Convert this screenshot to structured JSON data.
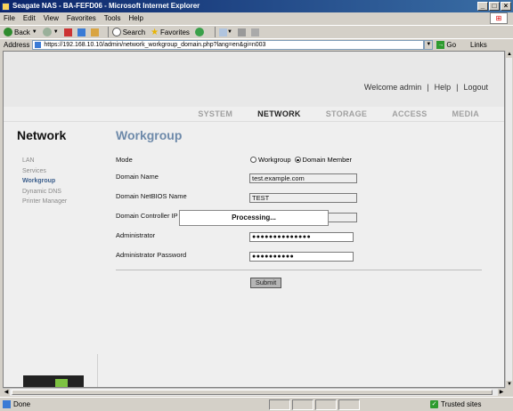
{
  "window": {
    "title": "Seagate NAS - BA-FEFD06 - Microsoft Internet Explorer"
  },
  "menubar": [
    {
      "label": "File"
    },
    {
      "label": "Edit"
    },
    {
      "label": "View"
    },
    {
      "label": "Favorites"
    },
    {
      "label": "Tools"
    },
    {
      "label": "Help"
    }
  ],
  "toolbar": {
    "back_label": "Back",
    "search_label": "Search",
    "favorites_label": "Favorites"
  },
  "address": {
    "label": "Address",
    "url": "https://192.168.10.10/admin/network_workgroup_domain.php?lang=en&gi=n003",
    "go_label": "Go",
    "links_label": "Links"
  },
  "header": {
    "welcome": "Welcome admin",
    "sep": "|",
    "help": "Help",
    "logout": "Logout"
  },
  "navtabs": [
    {
      "label": "SYSTEM",
      "active": false
    },
    {
      "label": "NETWORK",
      "active": true
    },
    {
      "label": "STORAGE",
      "active": false
    },
    {
      "label": "ACCESS",
      "active": false
    },
    {
      "label": "MEDIA",
      "active": false
    }
  ],
  "sidebar": {
    "title": "Network",
    "items": [
      {
        "label": "LAN",
        "active": false
      },
      {
        "label": "Services",
        "active": false
      },
      {
        "label": "Workgroup",
        "active": true
      },
      {
        "label": "Dynamic DNS",
        "active": false
      },
      {
        "label": "Printer Manager",
        "active": false
      }
    ]
  },
  "main": {
    "title": "Workgroup",
    "mode_label": "Mode",
    "mode_options": [
      {
        "label": "Workgroup",
        "checked": false
      },
      {
        "label": "Domain Member",
        "checked": true
      }
    ],
    "domain_name_label": "Domain Name",
    "domain_name_value": "test.example.com",
    "netbios_label": "Domain NetBIOS Name",
    "netbios_value": "TEST",
    "controller_label": "Domain Controller IP",
    "controller_value": "",
    "admin_label": "Administrator",
    "admin_value": "●●●●●●●●●●●●●●",
    "admin_pwd_label": "Administrator Password",
    "admin_pwd_value": "●●●●●●●●●●",
    "submit_label": "Submit",
    "processing_text": "Processing..."
  },
  "statusbar": {
    "status": "Done",
    "zone": "Trusted sites"
  }
}
